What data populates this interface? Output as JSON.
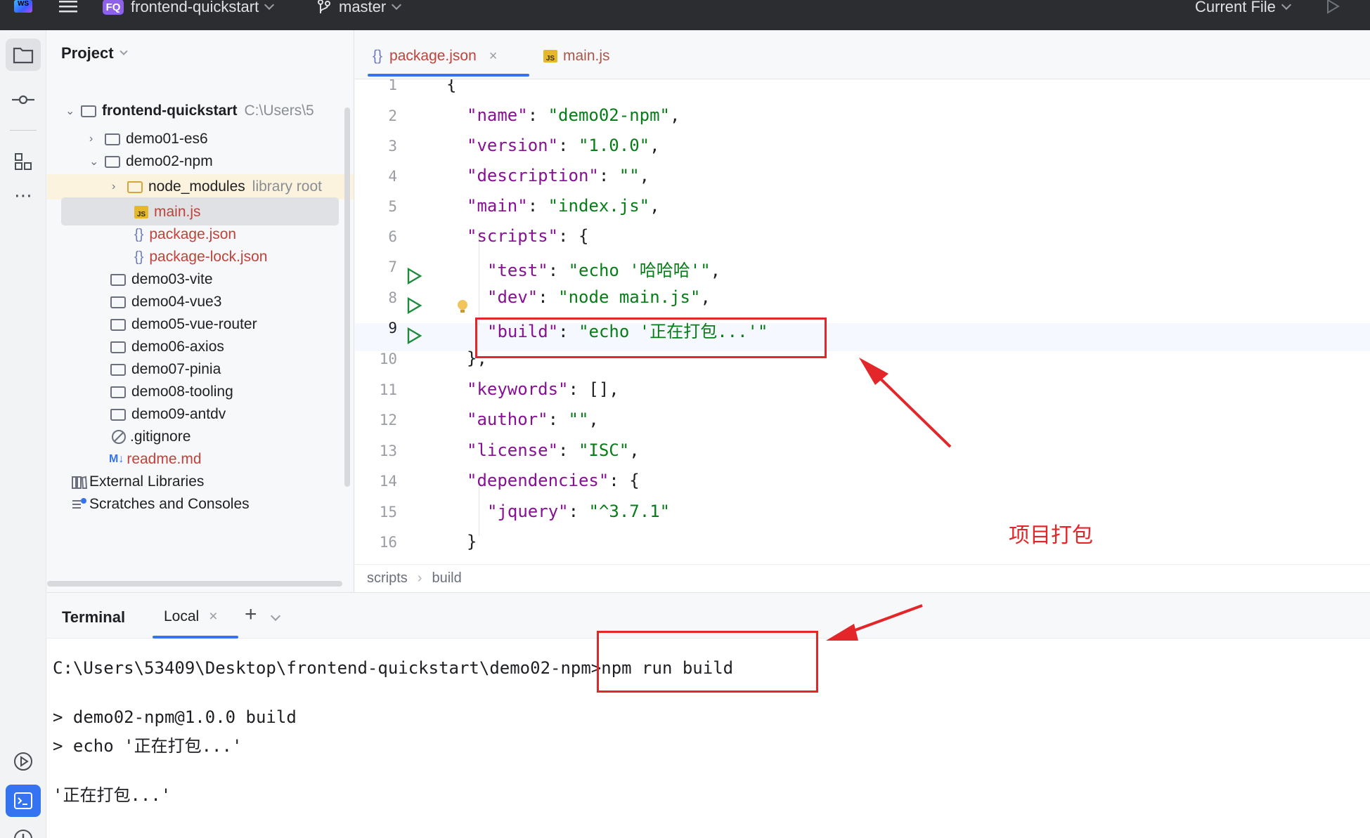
{
  "titlebar": {
    "project_badge": "FQ",
    "project_name": "frontend-quickstart",
    "branch": "master",
    "run_config": "Current File"
  },
  "project_panel": {
    "title": "Project",
    "root": {
      "name": "frontend-quickstart",
      "path": "C:\\Users\\5"
    },
    "items": [
      {
        "label": "demo01-es6"
      },
      {
        "label": "demo02-npm"
      },
      {
        "label": "node_modules",
        "hint": "library root"
      },
      {
        "label": "main.js"
      },
      {
        "label": "package.json"
      },
      {
        "label": "package-lock.json"
      },
      {
        "label": "demo03-vite"
      },
      {
        "label": "demo04-vue3"
      },
      {
        "label": "demo05-vue-router"
      },
      {
        "label": "demo06-axios"
      },
      {
        "label": "demo07-pinia"
      },
      {
        "label": "demo08-tooling"
      },
      {
        "label": "demo09-antdv"
      },
      {
        "label": ".gitignore"
      },
      {
        "label": "readme.md",
        "icon_text": "M↓"
      },
      {
        "label": "External Libraries"
      },
      {
        "label": "Scratches and Consoles"
      }
    ]
  },
  "editor": {
    "tabs": [
      {
        "label": "package.json",
        "icon": "{}"
      },
      {
        "label": "main.js",
        "icon": "JS"
      }
    ],
    "line_numbers": [
      "1",
      "2",
      "3",
      "4",
      "5",
      "6",
      "7",
      "8",
      "9",
      "10",
      "11",
      "12",
      "13",
      "14",
      "15",
      "16"
    ],
    "lines": [
      {
        "k": "",
        "rest": "{"
      },
      {
        "k": "\"name\"",
        "sep": ": ",
        "v": "\"demo02-npm\"",
        "end": ","
      },
      {
        "k": "\"version\"",
        "sep": ": ",
        "v": "\"1.0.0\"",
        "end": ","
      },
      {
        "k": "\"description\"",
        "sep": ": ",
        "v": "\"\"",
        "end": ","
      },
      {
        "k": "\"main\"",
        "sep": ": ",
        "v": "\"index.js\"",
        "end": ","
      },
      {
        "k": "\"scripts\"",
        "sep": ": ",
        "v": "",
        "end": "{"
      },
      {
        "k": "\"test\"",
        "sep": ": ",
        "v": "\"echo '哈哈哈'\"",
        "end": ","
      },
      {
        "k": "\"dev\"",
        "sep": ": ",
        "v": "\"node main.js\"",
        "end": ","
      },
      {
        "k": "\"build\"",
        "sep": ": ",
        "v": "\"echo '正在打包...'\"",
        "end": ""
      },
      {
        "k": "",
        "rest": "},"
      },
      {
        "k": "\"keywords\"",
        "sep": ": ",
        "v": "",
        "end": "[],"
      },
      {
        "k": "\"author\"",
        "sep": ": ",
        "v": "\"\"",
        "end": ","
      },
      {
        "k": "\"license\"",
        "sep": ": ",
        "v": "\"ISC\"",
        "end": ","
      },
      {
        "k": "\"dependencies\"",
        "sep": ": ",
        "v": "",
        "end": "{"
      },
      {
        "k": "\"jquery\"",
        "sep": ": ",
        "v": "\"^3.7.1\"",
        "end": ""
      },
      {
        "k": "",
        "rest": "}"
      }
    ],
    "breadcrumbs": [
      "scripts",
      "build"
    ]
  },
  "terminal": {
    "title": "Terminal",
    "tab": "Local",
    "lines": [
      "C:\\Users\\53409\\Desktop\\frontend-quickstart\\demo02-npm>npm run build",
      "> demo02-npm@1.0.0 build",
      "> echo '正在打包...'",
      "'正在打包...'"
    ]
  },
  "annotation": {
    "note": "项目打包",
    "color": "#e3262a"
  },
  "colors": {
    "accent": "#3574f0",
    "key": "#871094",
    "string": "#067d17",
    "run_gutter": "#208a3c"
  }
}
